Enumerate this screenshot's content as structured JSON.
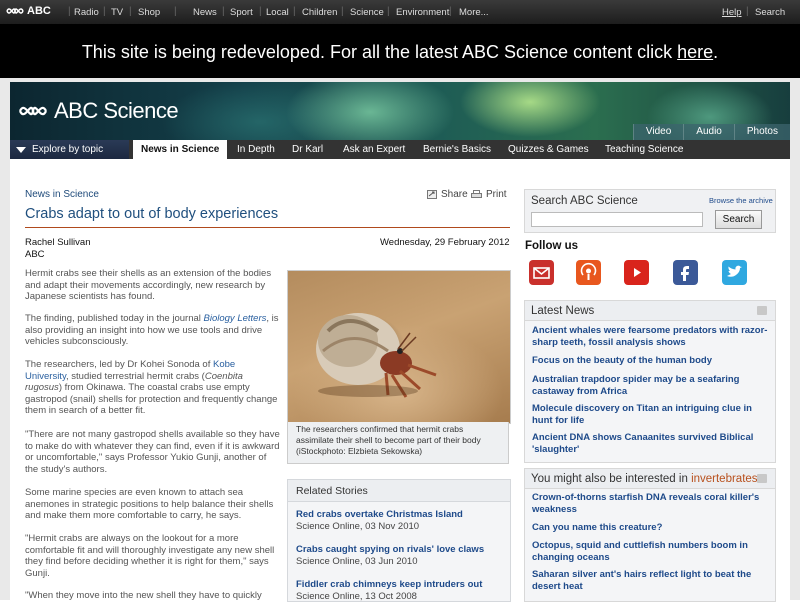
{
  "topnav": {
    "logo": "ABC",
    "left_items": [
      "Radio",
      "TV",
      "Shop"
    ],
    "mid_items": [
      "News",
      "Sport",
      "Local",
      "Children",
      "Science",
      "Environment",
      "More..."
    ],
    "help": "Help",
    "search": "Search"
  },
  "banner": {
    "text": "This site is being redeveloped. For all the latest ABC Science content click",
    "link": "here",
    "end": "."
  },
  "header": {
    "brand": "ABC Science",
    "media": [
      "Video",
      "Audio",
      "Photos"
    ]
  },
  "secnav": {
    "explore": "Explore by topic",
    "tabs": [
      "News in Science",
      "In Depth",
      "Dr Karl",
      "Ask an Expert",
      "Bernie's Basics",
      "Quizzes & Games",
      "Teaching Science"
    ]
  },
  "article": {
    "crumb": "News in Science",
    "share": "Share",
    "print": "Print",
    "title": "Crabs adapt to out of body experiences",
    "author": "Rachel Sullivan",
    "source": "ABC",
    "date": "Wednesday, 29 February 2012",
    "p1": "Hermit crabs see their shells as an extension of the bodies and adapt their movements accordingly, new research by Japanese scientists has found.",
    "p2a": "The finding, published today in the journal ",
    "p2link": "Biology Letters",
    "p2b": ", is also providing an insight into how we use tools and drive vehicles subconsciously.",
    "p3a": "The researchers, led by Dr Kohei Sonoda of ",
    "p3link": "Kobe University",
    "p3b": ", studied terrestrial hermit crabs (",
    "p3i": "Coenbita rugosus",
    "p3c": ") from Okinawa. The coastal crabs use empty gastropod (snail) shells for protection and frequently change them in search of a better fit.",
    "p4": "\"There are not many gastropod shells available so they have to make do with whatever they can find, even if it is awkward or uncomfortable,\" says Professor Yukio Gunji, another of the study's authors.",
    "p5": "Some marine species are even known to attach sea anemones in strategic positions to help balance their shells and make them more comfortable to carry, he says.",
    "p6": "\"Hermit crabs are always on the lookout for a more comfortable fit and will thoroughly investigate any new shell they find before deciding whether it is right for them,\" says Gunji.",
    "p7": "\"When they move into the new shell they have to quickly"
  },
  "photo": {
    "caption": "The researchers confirmed that hermit crabs assimilate their shell to become part of their body (iStockphoto: Elzbieta Sekowska)"
  },
  "related": {
    "heading": "Related Stories",
    "items": [
      {
        "title": "Red crabs overtake Christmas Island",
        "source": "Science Online, 03 Nov 2010"
      },
      {
        "title": "Crabs caught spying on rivals' love claws",
        "source": "Science Online, 03 Jun 2010"
      },
      {
        "title": "Fiddler crab chimneys keep intruders out",
        "source": "Science Online, 13 Oct 2008"
      }
    ]
  },
  "sidebar": {
    "search_heading": "Search ABC Science",
    "browse": "Browse the archive",
    "search_button": "Search",
    "search_value": "",
    "follow": "Follow us",
    "social": [
      {
        "name": "email",
        "color": "#c9302c"
      },
      {
        "name": "podcast",
        "color": "#e8571e"
      },
      {
        "name": "youtube",
        "color": "#d9241c"
      },
      {
        "name": "facebook",
        "color": "#3b5998"
      },
      {
        "name": "twitter",
        "color": "#2fa8e0"
      }
    ],
    "latest_heading": "Latest News",
    "latest": [
      "Ancient whales were fearsome predators with razor-sharp teeth, fossil analysis shows",
      "Focus on the beauty of the human body",
      "Australian trapdoor spider may be a seafaring castaway from Africa",
      "Molecule discovery on Titan an intriguing clue in hunt for life",
      "Ancient DNA shows Canaanites survived Biblical 'slaughter'"
    ],
    "interest_heading": "You might also be interested in",
    "interest_keyword": "invertebrates",
    "interest": [
      "Crown-of-thorns starfish DNA reveals coral killer's weakness",
      "Can you name this creature?",
      "Octopus, squid and cuttlefish numbers boom in changing oceans",
      "Saharan silver ant's hairs reflect light to beat the desert heat"
    ]
  }
}
